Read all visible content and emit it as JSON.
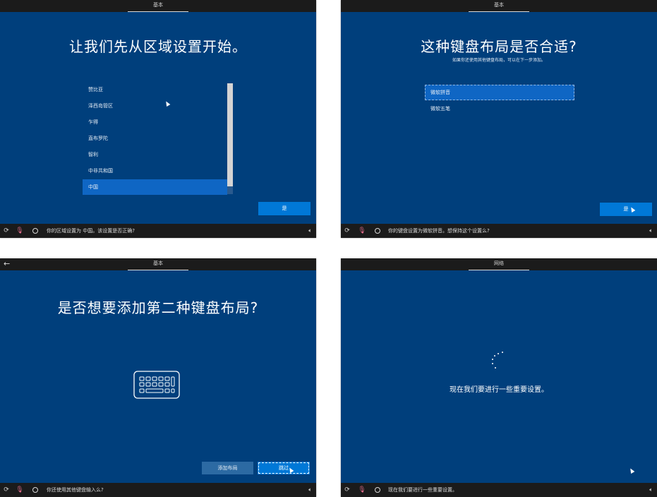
{
  "panel1": {
    "tab": "基本",
    "heading": "让我们先从区域设置开始。",
    "regions": [
      "赞比亚",
      "泽西岛管区",
      "乍得",
      "直布罗陀",
      "智利",
      "中非共和国",
      "中国"
    ],
    "selected_region": "中国",
    "yes_button": "是",
    "taskbar_text": "你的区域设置为 中国。该设置是否正确?"
  },
  "panel2": {
    "tab": "基本",
    "heading": "这种键盘布局是否合适?",
    "subtext": "如果你还使用其他键盘布局，可以在下一步添加。",
    "layouts": [
      "微软拼音",
      "微软五笔"
    ],
    "selected_layout": "微软拼音",
    "yes_button": "是",
    "taskbar_text": "你的键盘设置为微软拼音。想保持这个设置么?"
  },
  "panel3": {
    "tab": "基本",
    "heading": "是否想要添加第二种键盘布局?",
    "add_layout_button": "添加布局",
    "skip_button": "跳过",
    "taskbar_text": "你还使用其他键盘输入么?"
  },
  "panel4": {
    "tab": "网络",
    "status_text": "现在我们要进行一些重要设置。",
    "taskbar_text": "现在我们要进行一些重要设置。"
  },
  "icons": {
    "taskbar_back": "undo-arrow-icon",
    "taskbar_mic": "microphone-icon",
    "taskbar_cortana": "cortana-circle-icon",
    "taskbar_volume": "volume-icon",
    "keyboard": "keyboard-icon",
    "spinner": "loading-spinner-icon"
  },
  "colors": {
    "background_blue": "#003f7c",
    "accent_blue": "#0078d7",
    "selected_blue": "#0f66c4",
    "bar_dark": "#1b1b1b"
  }
}
